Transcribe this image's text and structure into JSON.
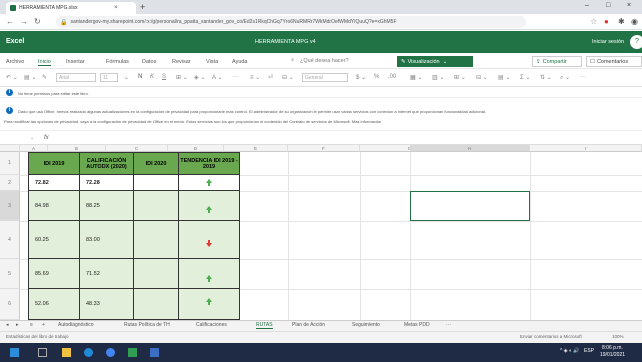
{
  "browser": {
    "tab_title": "HERRAMIENTA MPG.xlsx",
    "url": "santandergov-my.sharepoint.com/:x:/g/personal/ra_ppatta_santander_gov_co/Ed2s1RkqChGq7Yro6NuRMRr7WkMdrOefWMdYIQuuQ?e=xGhM5F",
    "tab_close": "×",
    "new_tab": "+",
    "win_controls": [
      "–",
      "□",
      "×"
    ]
  },
  "excel": {
    "brand": "Excel",
    "doc_title": "HERRAMIENTA MPG v4",
    "sign_in": "Iniciar sesión",
    "avatar": "?",
    "ribbon_tabs": [
      "Archivo",
      "Inicio",
      "Insertar",
      "Fórmulas",
      "Datos",
      "Revisar",
      "Vista",
      "Ayuda"
    ],
    "active_tab": "Inicio",
    "tell_me": "¿Qué desea hacer?",
    "view_button": "Visualización",
    "share_button": "Compartir",
    "comments_button": "Comentarios",
    "toolbar": {
      "font_name": "Arial",
      "font_size": "11",
      "number_format": "General"
    },
    "notifications": [
      "No tiene permisos para editar este libro.",
      "Dado que usa Office, hemos realizado algunas actualizaciones en la configuración de privacidad para proporcionarle más control. El administrador de su organización le permite usar varias servicios con conexión a internet que proporcionan funcionalidad adicional.",
      "Para modificar las opciones de privacidad, vaya a la configuración de privacidad de Office en el menú. Estos servicios son los que proporcionan el contenido del Contrato de servicios de Microsoft. Más información"
    ],
    "formula_bar": {
      "name_box": "",
      "fx": "fx",
      "content": ""
    },
    "columns": [
      "A",
      "B",
      "C",
      "D",
      "E",
      "F",
      "G",
      "H",
      "I",
      "J"
    ],
    "rows": [
      "1",
      "2",
      "3",
      "4",
      "5",
      "6"
    ],
    "table": {
      "headers": [
        "IDI 2019",
        "CALIFICACIÓN AUTODX (2020)",
        "IDI 2020",
        "TENDENCIA IDI 2019 - 2019"
      ],
      "rows": [
        {
          "idi2019": "72.82",
          "calif": "72.28",
          "idi2020": "",
          "trend": "up"
        },
        {
          "idi2019": "84.98",
          "calif": "88.25",
          "idi2020": "",
          "trend": "up"
        },
        {
          "idi2019": "60.25",
          "calif": "83.00",
          "idi2020": "",
          "trend": "down"
        },
        {
          "idi2019": "85.69",
          "calif": "71.52",
          "idi2020": "",
          "trend": "up"
        },
        {
          "idi2019": "52.06",
          "calif": "48.33",
          "idi2020": "",
          "trend": "up"
        }
      ]
    },
    "sheet_tabs": [
      "Autodiagnóstico",
      "Rutas Política de TH",
      "Calificaciones",
      "RUTAS",
      "Plan de Acción",
      "Seguimiento",
      "Metas PDD"
    ],
    "active_sheet": "RUTAS",
    "status_left": "Estadísticas del libro de trabajo",
    "status_right": "Enviar comentarios a Microsoft",
    "zoom": "100%"
  },
  "taskbar": {
    "time": "8:06 p.m.",
    "date": "19/01/2021",
    "lang": "ESP"
  }
}
